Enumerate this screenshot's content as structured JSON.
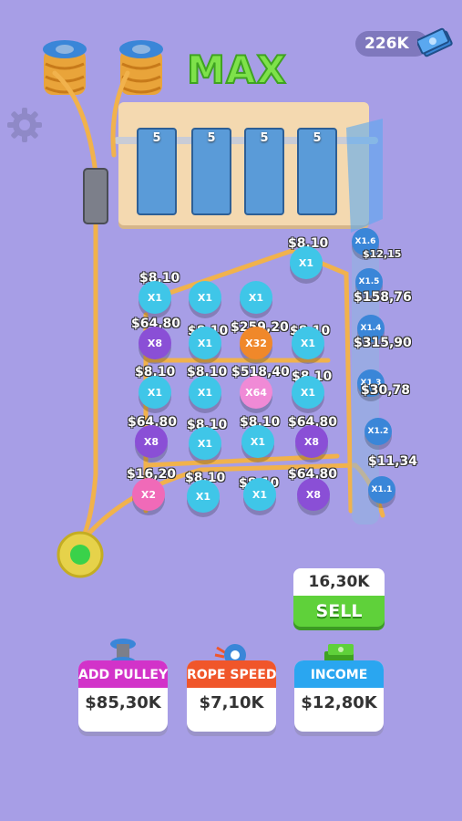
{
  "hud": {
    "money": "226K",
    "money_icon": "cash-stack-icon",
    "settings_icon": "gear-icon",
    "max_label": "MAX"
  },
  "board": {
    "rack_labels": [
      "5",
      "5",
      "5",
      "5"
    ]
  },
  "right_column": {
    "multipliers": [
      "X1.6",
      "X1.5",
      "X1.4",
      "X1.3",
      "X1.2",
      "X1.1"
    ],
    "prices": [
      "$12,15",
      "$158,76",
      "$315,90",
      "$30,78",
      "$11,34"
    ]
  },
  "grid": {
    "top_price": "$8,10",
    "rows": [
      {
        "prices": [
          "$8,10",
          "",
          "",
          ""
        ],
        "pegs": [
          "X1",
          "X1",
          "X1",
          ""
        ]
      },
      {
        "prices": [
          "$64,80",
          "$8,10",
          "$259,20",
          "$8,10"
        ],
        "pegs": [
          "X8",
          "X1",
          "X32",
          "X1"
        ]
      },
      {
        "prices": [
          "$8,10",
          "$8,10",
          "$518,40",
          "$8,10"
        ],
        "pegs": [
          "X1",
          "X1",
          "X64",
          "X1"
        ]
      },
      {
        "prices": [
          "$64,80",
          "$8,10",
          "$8,10",
          "$64,80"
        ],
        "pegs": [
          "X8",
          "X1",
          "X1",
          "X8"
        ]
      },
      {
        "prices": [
          "$16,20",
          "$8,10",
          "$8,10",
          "$64,80"
        ],
        "pegs": [
          "X2",
          "X1",
          "X1",
          "X8"
        ]
      }
    ]
  },
  "sell": {
    "value": "16,30K",
    "label": "SELL"
  },
  "upgrades": [
    {
      "title": "ADD PULLEY",
      "price": "$85,30K",
      "color": "#d233c9",
      "icon": "pulley-icon"
    },
    {
      "title": "ROPE SPEED",
      "price": "$7,10K",
      "color": "#f0562a",
      "icon": "gear-speed-icon"
    },
    {
      "title": "INCOME",
      "price": "$12,80K",
      "color": "#2aa6f0",
      "icon": "cash-pile-icon"
    }
  ]
}
